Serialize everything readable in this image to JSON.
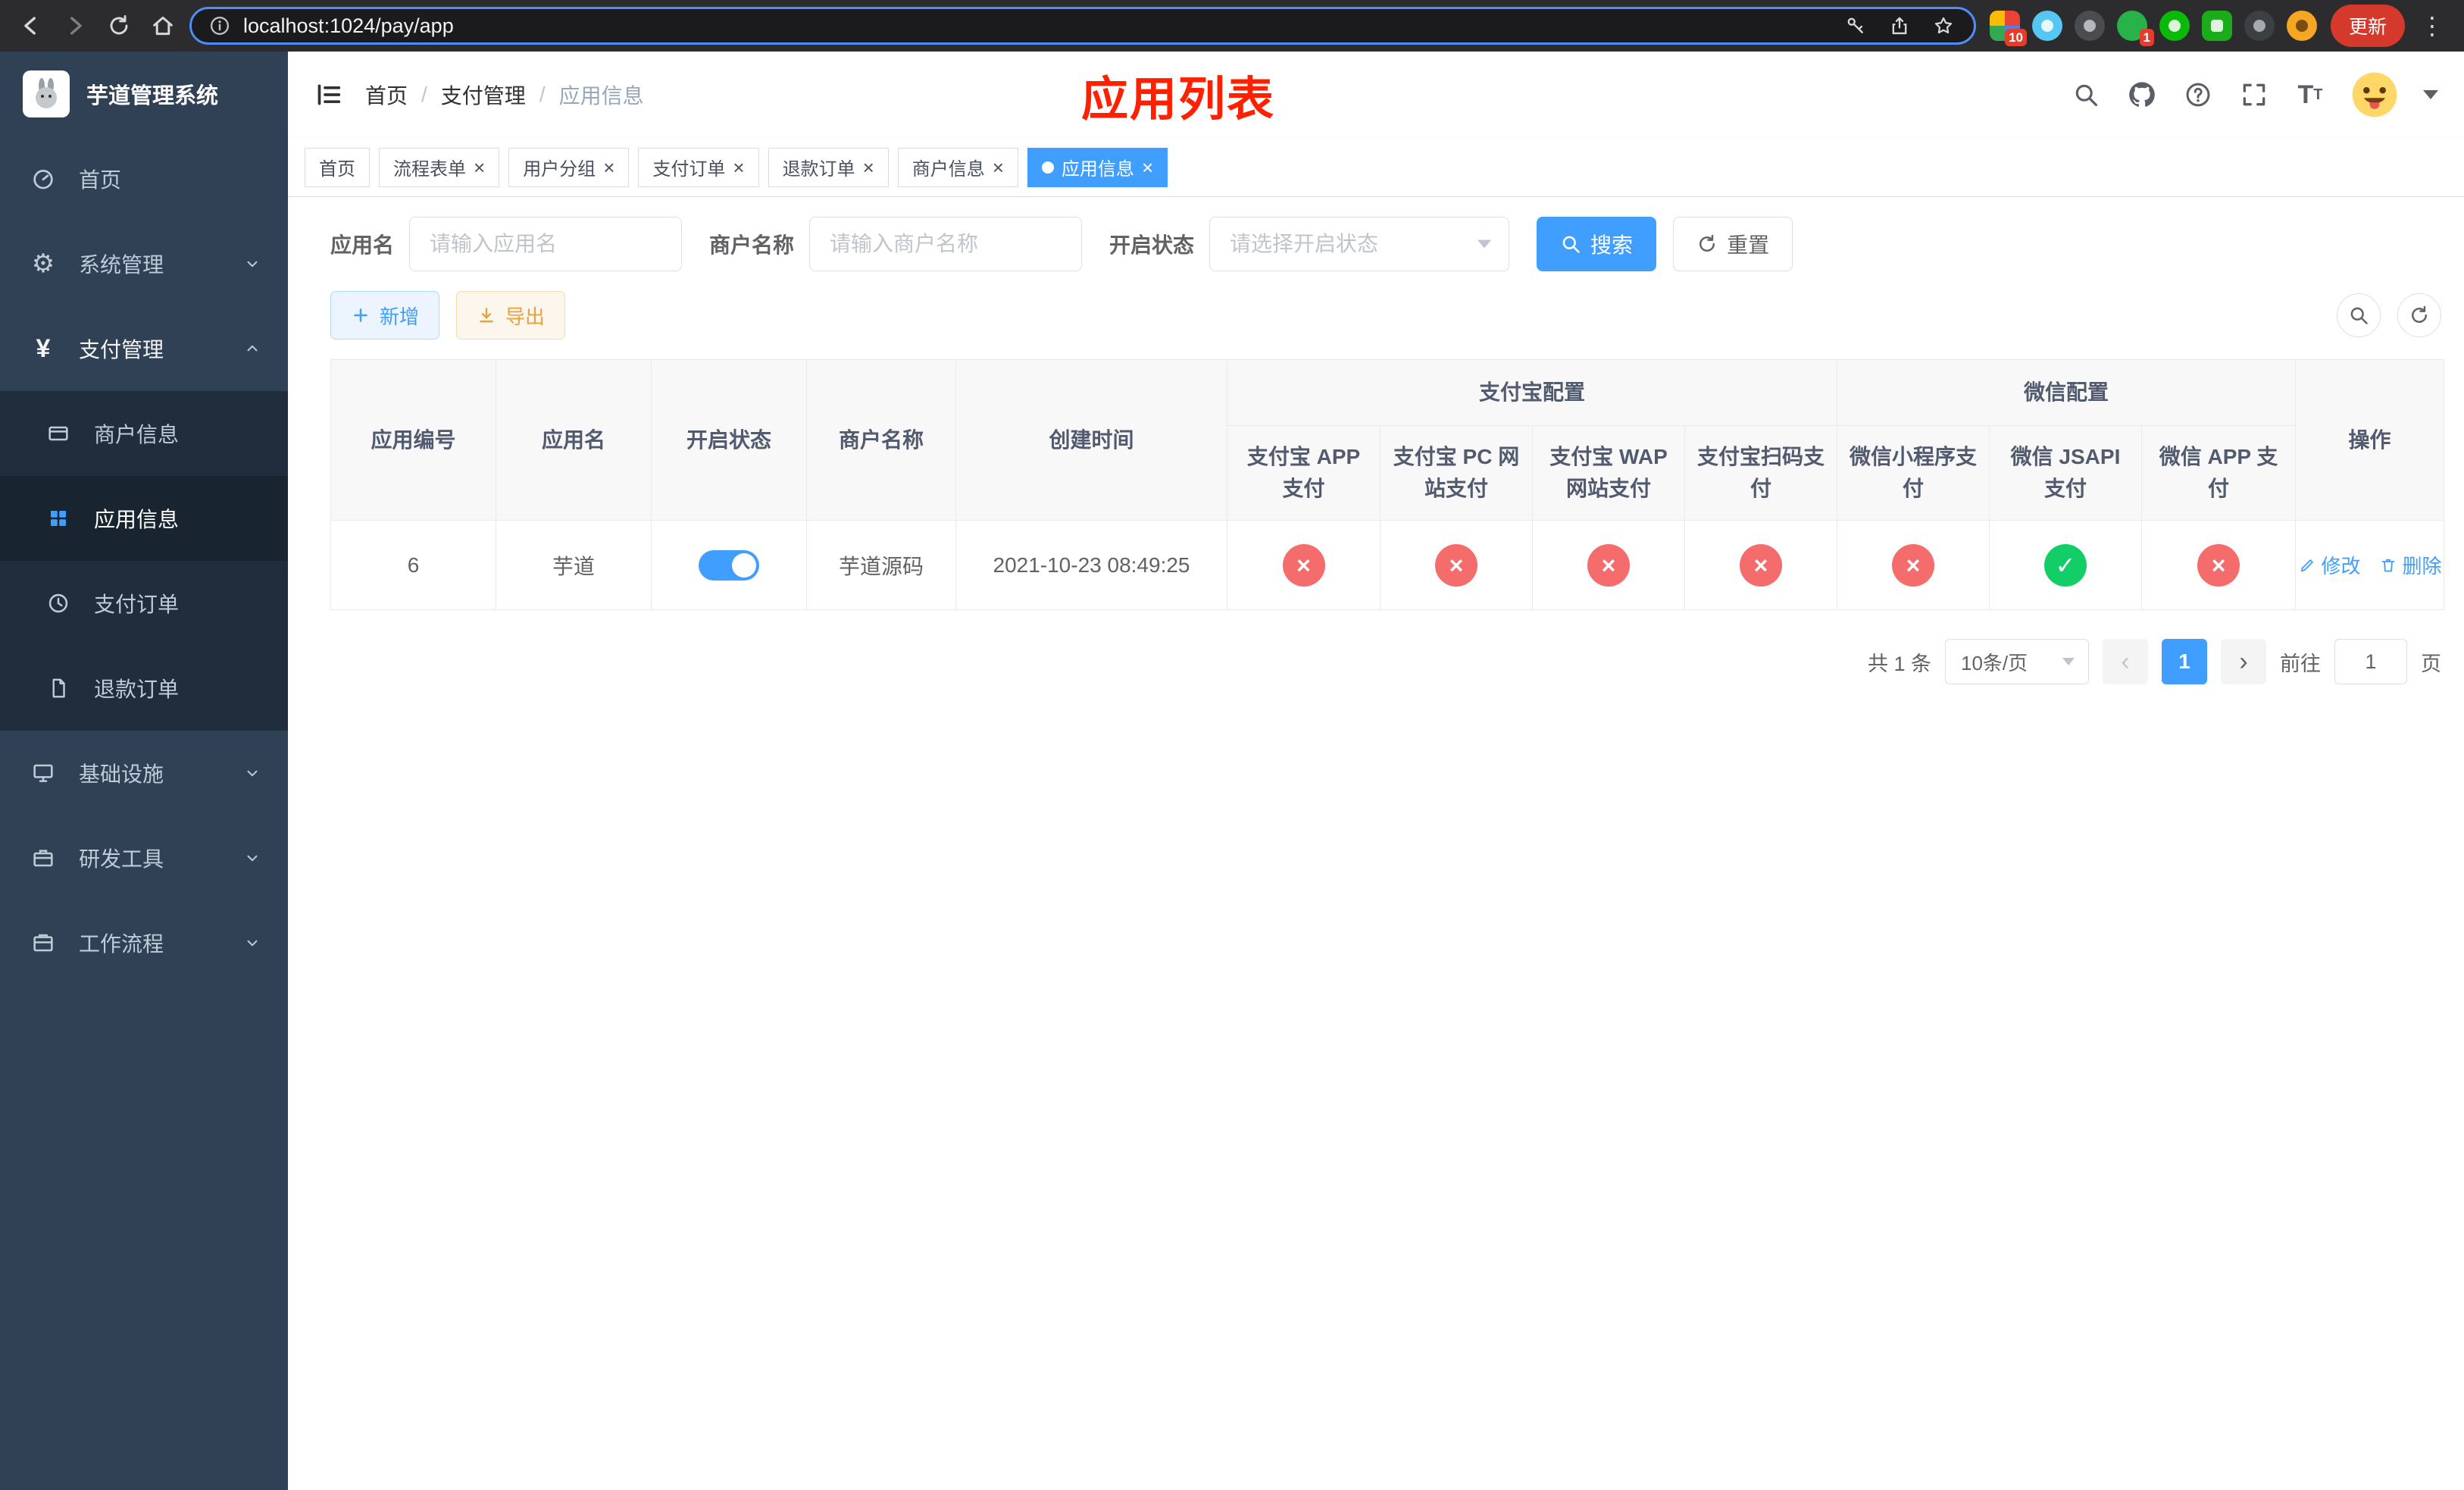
{
  "browser": {
    "url": "localhost:1024/pay/app",
    "update_label": "更新",
    "ext_badge_1": "10",
    "ext_badge_2": "1"
  },
  "icons": {
    "close": "×",
    "check": "✓",
    "cross": "×",
    "chevron_left": "‹",
    "chevron_right": "›",
    "kebab": "⋮",
    "gear": "⚙",
    "yen": "¥"
  },
  "sidebar": {
    "title": "芋道管理系统",
    "menu": [
      {
        "label": "首页"
      },
      {
        "label": "系统管理"
      },
      {
        "label": "支付管理"
      },
      {
        "label": "基础设施"
      },
      {
        "label": "研发工具"
      },
      {
        "label": "工作流程"
      }
    ],
    "pay_children": [
      {
        "label": "商户信息"
      },
      {
        "label": "应用信息"
      },
      {
        "label": "支付订单"
      },
      {
        "label": "退款订单"
      }
    ]
  },
  "header": {
    "breadcrumb": [
      "首页",
      "支付管理",
      "应用信息"
    ],
    "page_title": "应用列表"
  },
  "tabs": [
    {
      "label": "首页"
    },
    {
      "label": "流程表单"
    },
    {
      "label": "用户分组"
    },
    {
      "label": "支付订单"
    },
    {
      "label": "退款订单"
    },
    {
      "label": "商户信息"
    },
    {
      "label": "应用信息"
    }
  ],
  "filters": {
    "app_name_label": "应用名",
    "app_name_placeholder": "请输入应用名",
    "merchant_label": "商户名称",
    "merchant_placeholder": "请输入商户名称",
    "status_label": "开启状态",
    "status_placeholder": "请选择开启状态",
    "search_label": "搜索",
    "reset_label": "重置"
  },
  "toolbar": {
    "add_label": "新增",
    "export_label": "导出"
  },
  "table": {
    "col_id": "应用编号",
    "col_name": "应用名",
    "col_status": "开启状态",
    "col_merchant": "商户名称",
    "col_created": "创建时间",
    "group_alipay": "支付宝配置",
    "group_wechat": "微信配置",
    "col_alipay_app": "支付宝 APP 支付",
    "col_alipay_pc": "支付宝 PC 网站支付",
    "col_alipay_wap": "支付宝 WAP 网站支付",
    "col_alipay_qr": "支付宝扫码支付",
    "col_wx_mini": "微信小程序支付",
    "col_wx_jsapi": "微信 JSAPI 支付",
    "col_wx_app": "微信 APP 支付",
    "col_actions": "操作",
    "rows": [
      {
        "id": "6",
        "name": "芋道",
        "enabled": true,
        "merchant": "芋道源码",
        "created": "2021-10-23 08:49:25",
        "alipay_app": false,
        "alipay_pc": false,
        "alipay_wap": false,
        "alipay_qr": false,
        "wx_mini": false,
        "wx_jsapi": true,
        "wx_app": false,
        "edit_label": "修改",
        "delete_label": "删除"
      }
    ]
  },
  "pagination": {
    "total": "共 1 条",
    "page_size": "10条/页",
    "page": "1",
    "goto_label": "前往",
    "goto_value": "1",
    "unit_label": "页"
  },
  "colors": {
    "primary": "#409eff",
    "success": "#13ce66",
    "danger": "#f56c6c",
    "warning": "#e6a23c",
    "sidebar_bg": "#304156",
    "annotation_red": "#ff2000"
  }
}
